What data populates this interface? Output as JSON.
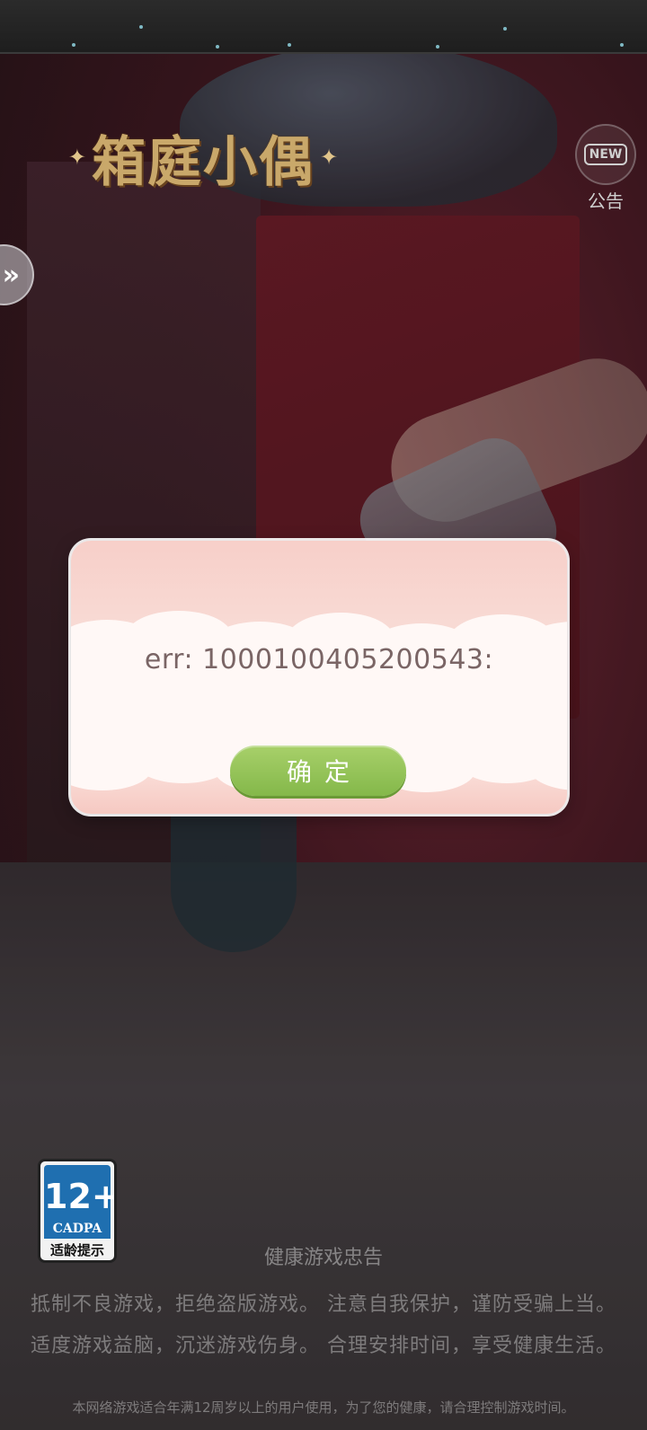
{
  "game": {
    "logo_text": "箱庭小偶"
  },
  "notice": {
    "badge": "NEW",
    "label": "公告"
  },
  "side_button": {
    "glyph": "»"
  },
  "dialog": {
    "message": "err: 1000100405200543:",
    "confirm_label": "确定"
  },
  "age_rating": {
    "age": "12+",
    "org": "CADPA",
    "tip": "适龄提示"
  },
  "health": {
    "title": "健康游戏忠告",
    "line1": "抵制不良游戏，拒绝盗版游戏。 注意自我保护，谨防受骗上当。",
    "line2": "适度游戏益脑，沉迷游戏伤身。 合理安排时间，享受健康生活。",
    "disclaimer": "本网络游戏适合年满12周岁以上的用户使用，为了您的健康，请合理控制游戏时间。"
  },
  "colors": {
    "confirm_button": "#8fc052",
    "age_badge_blue": "#1f6fb0",
    "logo_gold": "#c9a86a"
  }
}
